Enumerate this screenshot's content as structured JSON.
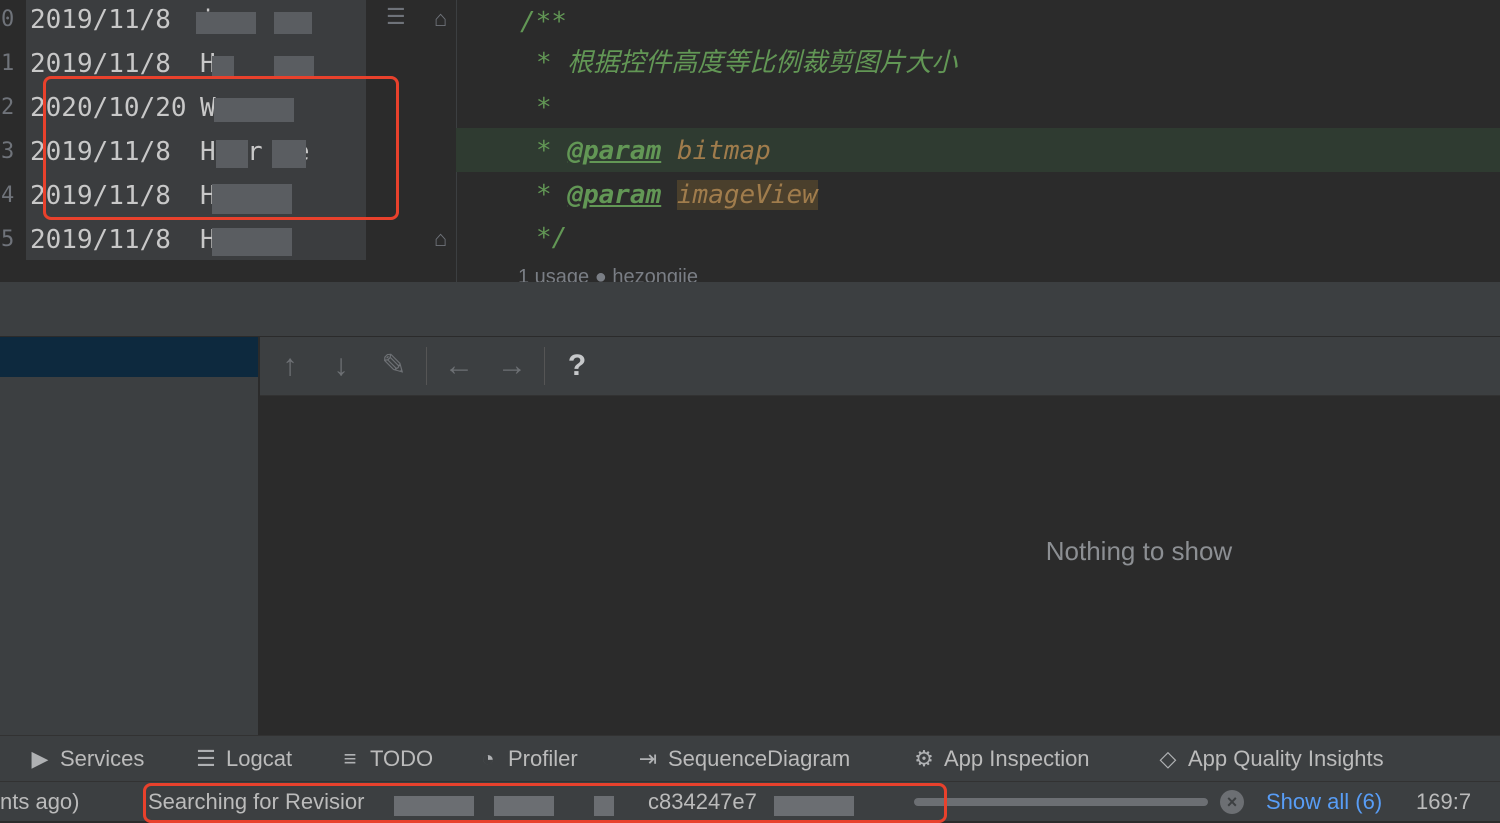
{
  "annotations": [
    {
      "line": "0",
      "date": "2019/11/8",
      "author": "  ie"
    },
    {
      "line": "1",
      "date": "2019/11/8",
      "author": "H"
    },
    {
      "line": "2",
      "date": "2020/10/20",
      "author": "W    g"
    },
    {
      "line": "3",
      "date": "2019/11/8",
      "author": "H  or  ie"
    },
    {
      "line": "4",
      "date": "2019/11/8",
      "author": "H     jie"
    },
    {
      "line": "5",
      "date": "2019/11/8",
      "author": "H     jie"
    }
  ],
  "code": {
    "doc_open": "/**",
    "doc_line1": "* 根据控件高度等比例裁剪图片大小",
    "doc_star": "*",
    "param_tag": "@param",
    "param1_star": "*",
    "param1_name": "bitmap",
    "param2_star": "*",
    "param2_name": "imageView",
    "doc_close": "*/",
    "codelens": "1 usage   ● hezongjie"
  },
  "toolbar": {
    "up": "↑",
    "down": "↓",
    "edit": "✎",
    "back": "←",
    "forward": "→",
    "help": "?"
  },
  "content": {
    "empty_text": "Nothing to show"
  },
  "tool_windows": [
    {
      "label": "Services",
      "icon": "services-icon"
    },
    {
      "label": "Logcat",
      "icon": "logcat-icon"
    },
    {
      "label": "TODO",
      "icon": "todo-icon"
    },
    {
      "label": "Profiler",
      "icon": "profiler-icon"
    },
    {
      "label": "SequenceDiagram",
      "icon": "sequence-diagram-icon"
    },
    {
      "label": "App Inspection",
      "icon": "app-inspection-icon"
    },
    {
      "label": "App Quality Insights",
      "icon": "app-quality-insights-icon"
    }
  ],
  "status_bar": {
    "left_text": "nts ago)",
    "search_text": "Searching for Revisior",
    "revision_fragment": "c834247e7",
    "show_all": "Show all (6)",
    "cursor_pos": "169:7"
  },
  "colors": {
    "highlight_box": "#e8412c",
    "link": "#589df6",
    "doc_comment": "#629755"
  }
}
